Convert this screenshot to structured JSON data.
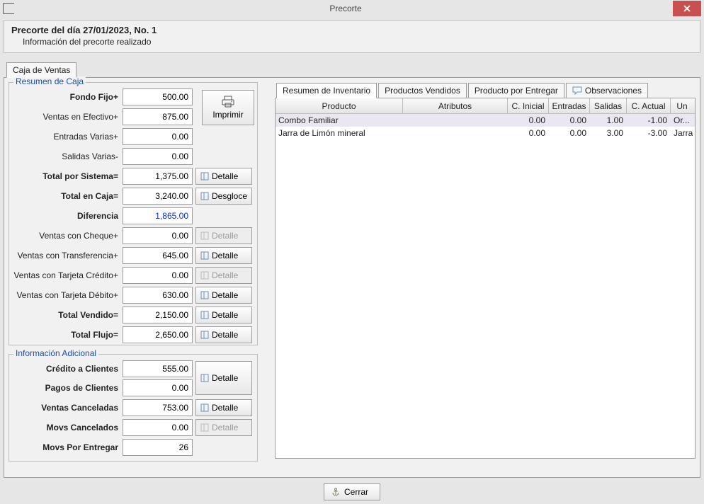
{
  "window": {
    "title": "Precorte",
    "close_tooltip": "Close"
  },
  "header": {
    "title": "Precorte del día 27/01/2023, No. 1",
    "subtitle": "Información del precorte realizado"
  },
  "tabs": {
    "caja_ventas": "Caja de Ventas"
  },
  "resumen": {
    "legend": "Resumen de Caja",
    "fondo_fijo_label": "Fondo Fijo+",
    "fondo_fijo": "500.00",
    "ventas_efectivo_label": "Ventas en Efectivo+",
    "ventas_efectivo": "875.00",
    "entradas_varias_label": "Entradas Varias+",
    "entradas_varias": "0.00",
    "salidas_varias_label": "Salidas Varias-",
    "salidas_varias": "0.00",
    "total_sistema_label": "Total por Sistema=",
    "total_sistema": "1,375.00",
    "total_caja_label": "Total en Caja=",
    "total_caja": "3,240.00",
    "diferencia_label": "Diferencia",
    "diferencia": "1,865.00",
    "ventas_cheque_label": "Ventas con Cheque+",
    "ventas_cheque": "0.00",
    "ventas_transf_label": "Ventas con Transferencia+",
    "ventas_transf": "645.00",
    "ventas_tc_label": "Ventas con Tarjeta Crédito+",
    "ventas_tc": "0.00",
    "ventas_td_label": "Ventas con Tarjeta Débito+",
    "ventas_td": "630.00",
    "total_vendido_label": "Total Vendido=",
    "total_vendido": "2,150.00",
    "total_flujo_label": "Total Flujo=",
    "total_flujo": "2,650.00"
  },
  "info_adicional": {
    "legend": "Información Adicional",
    "credito_clientes_label": "Crédito a Clientes",
    "credito_clientes": "555.00",
    "pagos_clientes_label": "Pagos de Clientes",
    "pagos_clientes": "0.00",
    "ventas_canceladas_label": "Ventas Canceladas",
    "ventas_canceladas": "753.00",
    "movs_cancelados_label": "Movs Cancelados",
    "movs_cancelados": "0.00",
    "movs_entregar_label": "Movs Por Entregar",
    "movs_entregar": "26"
  },
  "buttons": {
    "imprimir": "Imprimir",
    "detalle": "Detalle",
    "desgloce": "Desgloce",
    "cerrar": "Cerrar"
  },
  "inv_tabs": {
    "resumen": "Resumen de Inventario",
    "vendidos": "Productos Vendidos",
    "entregar": "Producto por Entregar",
    "obs": "Observaciones"
  },
  "grid": {
    "headers": {
      "producto": "Producto",
      "atributos": "Atributos",
      "cinicial": "C. Inicial",
      "entradas": "Entradas",
      "salidas": "Salidas",
      "cactual": "C. Actual",
      "un": "Un"
    },
    "rows": [
      {
        "producto": "Combo Familiar",
        "atributos": "",
        "cinicial": "0.00",
        "entradas": "0.00",
        "salidas": "1.00",
        "cactual": "-1.00",
        "un": "Or..."
      },
      {
        "producto": "Jarra de Limón mineral",
        "atributos": "",
        "cinicial": "0.00",
        "entradas": "0.00",
        "salidas": "3.00",
        "cactual": "-3.00",
        "un": "Jarra"
      }
    ]
  }
}
